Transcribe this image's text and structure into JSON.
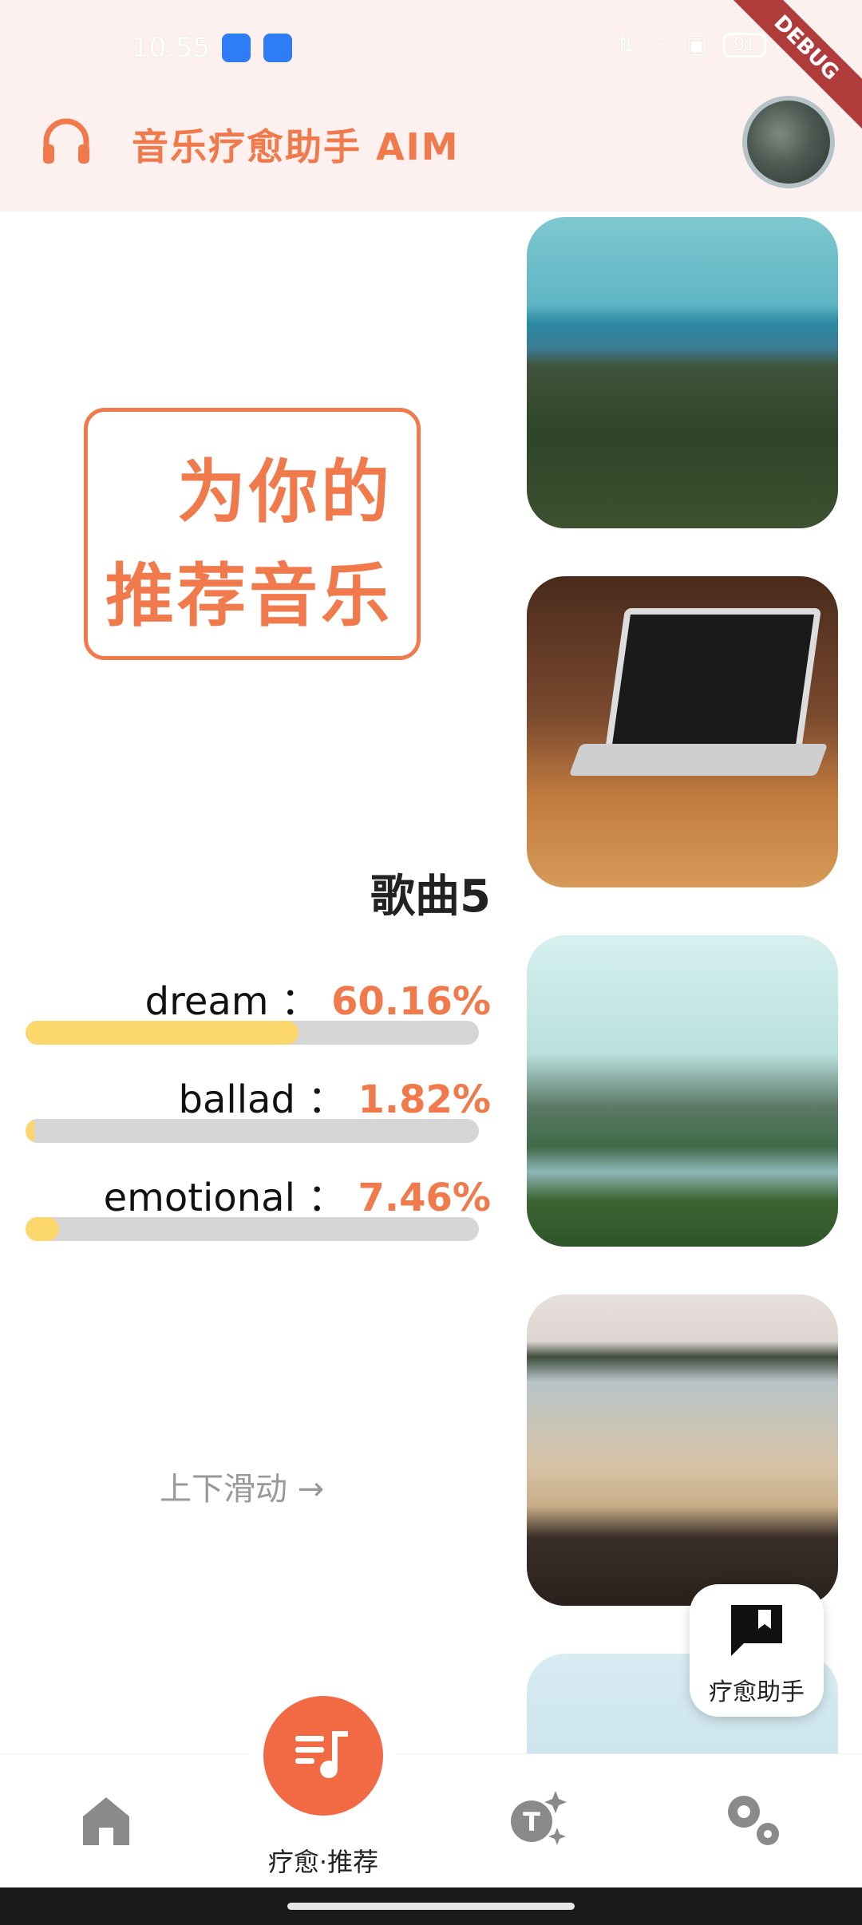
{
  "status_bar": {
    "time": "10:55",
    "battery": "91",
    "icons": [
      "bluetooth-icon",
      "link-icon",
      "data-speed-icon",
      "wifi-icon",
      "sim-icon"
    ]
  },
  "debug_banner": "DEBUG",
  "app_bar": {
    "title": "音乐疗愈助手 AIM",
    "leading_icon": "headphones-icon",
    "avatar": "avatar"
  },
  "recommendation": {
    "line1": "为你的",
    "line2": "推荐音乐"
  },
  "song": {
    "title": "歌曲5",
    "genres": [
      {
        "label": "dream",
        "separator": "：",
        "percent": "60.16%",
        "fraction": 0.6016
      },
      {
        "label": "ballad",
        "separator": "：",
        "percent": "1.82%",
        "fraction": 0.0182
      },
      {
        "label": "emotional",
        "separator": "：",
        "percent": "7.46%",
        "fraction": 0.0746
      }
    ]
  },
  "scroll_hint": "上下滑动 →",
  "floating_button": {
    "label": "疗愈助手",
    "icon": "bookmark-chat-icon"
  },
  "bottom_nav": {
    "items": [
      {
        "name": "home",
        "icon": "home-icon"
      },
      {
        "name": "recommend",
        "icon": "playlist-music-icon",
        "label": "疗愈·推荐"
      },
      {
        "name": "ai-text",
        "icon": "text-sparkle-icon"
      },
      {
        "name": "settings",
        "icon": "gears-icon"
      }
    ]
  },
  "colors": {
    "accent": "#f07a4c",
    "bar_fill": "#fcd76c",
    "bar_track": "#d6d6d6",
    "header_bg": "#fdf1ef"
  }
}
